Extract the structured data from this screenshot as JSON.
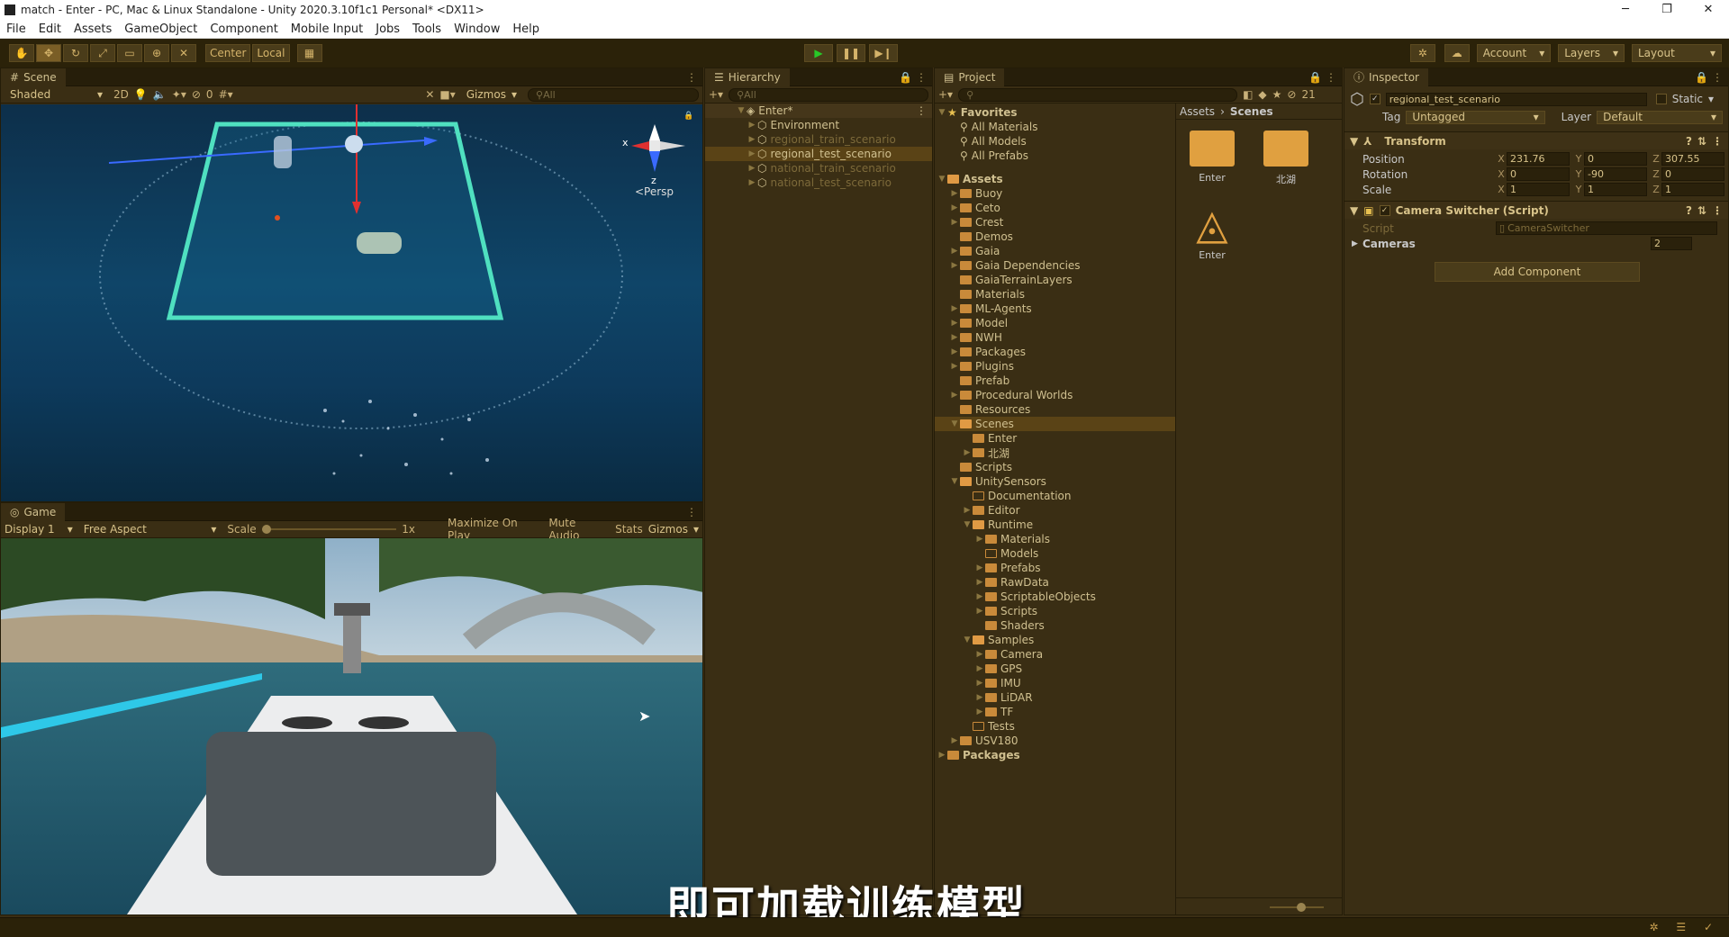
{
  "window": {
    "title": "match - Enter - PC, Mac & Linux Standalone - Unity 2020.3.10f1c1 Personal* <DX11>",
    "minimize": "─",
    "maximize": "❐",
    "close": "✕"
  },
  "menu": [
    "File",
    "Edit",
    "Assets",
    "GameObject",
    "Component",
    "Mobile Input",
    "Jobs",
    "Tools",
    "Window",
    "Help"
  ],
  "toolbar": {
    "pivot": "Center",
    "space": "Local",
    "account": "Account",
    "layers": "Layers",
    "layout": "Layout"
  },
  "scene": {
    "tab": "Scene",
    "shading": "Shaded",
    "mode2d": "2D",
    "gizmos": "Gizmos",
    "search_placeholder": "All",
    "hidden_count": "0",
    "persp": "<Persp",
    "axis_x": "x",
    "axis_z": "z"
  },
  "game": {
    "tab": "Game",
    "display": "Display 1",
    "aspect": "Free Aspect",
    "scale_label": "Scale",
    "scale_value": "1x",
    "maximize": "Maximize On Play",
    "mute": "Mute Audio",
    "stats": "Stats",
    "gizmos": "Gizmos"
  },
  "hierarchy": {
    "tab": "Hierarchy",
    "search_placeholder": "All",
    "root": "Enter*",
    "items": [
      {
        "label": "Environment",
        "dim": false,
        "selected": false
      },
      {
        "label": "regional_train_scenario",
        "dim": true,
        "selected": false
      },
      {
        "label": "regional_test_scenario",
        "dim": false,
        "selected": true
      },
      {
        "label": "national_train_scenario",
        "dim": true,
        "selected": false
      },
      {
        "label": "national_test_scenario",
        "dim": true,
        "selected": false
      }
    ]
  },
  "project": {
    "tab": "Project",
    "hidden_count": "21",
    "favorites": "Favorites",
    "favorite_items": [
      "All Materials",
      "All Models",
      "All Prefabs"
    ],
    "assets_root": "Assets",
    "tree": [
      {
        "label": "Buoy",
        "depth": 1,
        "arrow": "▶",
        "type": "folder"
      },
      {
        "label": "Ceto",
        "depth": 1,
        "arrow": "▶",
        "type": "folder"
      },
      {
        "label": "Crest",
        "depth": 1,
        "arrow": "▶",
        "type": "folder"
      },
      {
        "label": "Demos",
        "depth": 1,
        "arrow": "",
        "type": "folder"
      },
      {
        "label": "Gaia",
        "depth": 1,
        "arrow": "▶",
        "type": "folder"
      },
      {
        "label": "Gaia Dependencies",
        "depth": 1,
        "arrow": "▶",
        "type": "folder"
      },
      {
        "label": "GaiaTerrainLayers",
        "depth": 1,
        "arrow": "",
        "type": "folder"
      },
      {
        "label": "Materials",
        "depth": 1,
        "arrow": "",
        "type": "folder"
      },
      {
        "label": "ML-Agents",
        "depth": 1,
        "arrow": "▶",
        "type": "folder"
      },
      {
        "label": "Model",
        "depth": 1,
        "arrow": "▶",
        "type": "folder"
      },
      {
        "label": "NWH",
        "depth": 1,
        "arrow": "▶",
        "type": "folder"
      },
      {
        "label": "Packages",
        "depth": 1,
        "arrow": "▶",
        "type": "folder"
      },
      {
        "label": "Plugins",
        "depth": 1,
        "arrow": "▶",
        "type": "folder"
      },
      {
        "label": "Prefab",
        "depth": 1,
        "arrow": "",
        "type": "folder"
      },
      {
        "label": "Procedural Worlds",
        "depth": 1,
        "arrow": "▶",
        "type": "folder"
      },
      {
        "label": "Resources",
        "depth": 1,
        "arrow": "",
        "type": "folder"
      },
      {
        "label": "Scenes",
        "depth": 1,
        "arrow": "▼",
        "type": "open",
        "selected": true
      },
      {
        "label": "Enter",
        "depth": 2,
        "arrow": "",
        "type": "folder"
      },
      {
        "label": "北湖",
        "depth": 2,
        "arrow": "▶",
        "type": "folder"
      },
      {
        "label": "Scripts",
        "depth": 1,
        "arrow": "",
        "type": "folder"
      },
      {
        "label": "UnitySensors",
        "depth": 1,
        "arrow": "▼",
        "type": "open"
      },
      {
        "label": "Documentation",
        "depth": 2,
        "arrow": "",
        "type": "empty"
      },
      {
        "label": "Editor",
        "depth": 2,
        "arrow": "▶",
        "type": "folder"
      },
      {
        "label": "Runtime",
        "depth": 2,
        "arrow": "▼",
        "type": "open"
      },
      {
        "label": "Materials",
        "depth": 3,
        "arrow": "▶",
        "type": "folder"
      },
      {
        "label": "Models",
        "depth": 3,
        "arrow": "",
        "type": "empty"
      },
      {
        "label": "Prefabs",
        "depth": 3,
        "arrow": "▶",
        "type": "folder"
      },
      {
        "label": "RawData",
        "depth": 3,
        "arrow": "▶",
        "type": "folder"
      },
      {
        "label": "ScriptableObjects",
        "depth": 3,
        "arrow": "▶",
        "type": "folder"
      },
      {
        "label": "Scripts",
        "depth": 3,
        "arrow": "▶",
        "type": "folder"
      },
      {
        "label": "Shaders",
        "depth": 3,
        "arrow": "",
        "type": "folder"
      },
      {
        "label": "Samples",
        "depth": 2,
        "arrow": "▼",
        "type": "open"
      },
      {
        "label": "Camera",
        "depth": 3,
        "arrow": "▶",
        "type": "folder"
      },
      {
        "label": "GPS",
        "depth": 3,
        "arrow": "▶",
        "type": "folder"
      },
      {
        "label": "IMU",
        "depth": 3,
        "arrow": "▶",
        "type": "folder"
      },
      {
        "label": "LiDAR",
        "depth": 3,
        "arrow": "▶",
        "type": "folder"
      },
      {
        "label": "TF",
        "depth": 3,
        "arrow": "▶",
        "type": "folder"
      },
      {
        "label": "Tests",
        "depth": 2,
        "arrow": "",
        "type": "empty"
      },
      {
        "label": "USV180",
        "depth": 1,
        "arrow": "▶",
        "type": "folder"
      }
    ],
    "packages_root": "Packages",
    "breadcrumb": [
      "Assets",
      "Scenes"
    ],
    "grid_items": [
      {
        "label": "Enter",
        "kind": "folder"
      },
      {
        "label": "北湖",
        "kind": "folder"
      },
      {
        "label": "Enter",
        "kind": "unity"
      }
    ]
  },
  "inspector": {
    "tab": "Inspector",
    "object_name": "regional_test_scenario",
    "static_label": "Static",
    "tag_label": "Tag",
    "tag_value": "Untagged",
    "layer_label": "Layer",
    "layer_value": "Default",
    "transform": {
      "title": "Transform",
      "rows": [
        {
          "label": "Position",
          "x": "231.76",
          "y": "0",
          "z": "307.55"
        },
        {
          "label": "Rotation",
          "x": "0",
          "y": "-90",
          "z": "0"
        },
        {
          "label": "Scale",
          "x": "1",
          "y": "1",
          "z": "1"
        }
      ]
    },
    "component": {
      "title": "Camera Switcher (Script)",
      "script_label": "Script",
      "script_value": "CameraSwitcher",
      "cameras_label": "Cameras",
      "cameras_value": "2"
    },
    "add_component": "Add Component"
  },
  "subtitle": "即可加载训练模型",
  "colors": {
    "panel": "#3a2e14",
    "tabbar": "#261e0a",
    "accent": "#d8c38a",
    "selection": "#5a4316",
    "folder": "#c98a3a",
    "play_green": "#28c828"
  }
}
